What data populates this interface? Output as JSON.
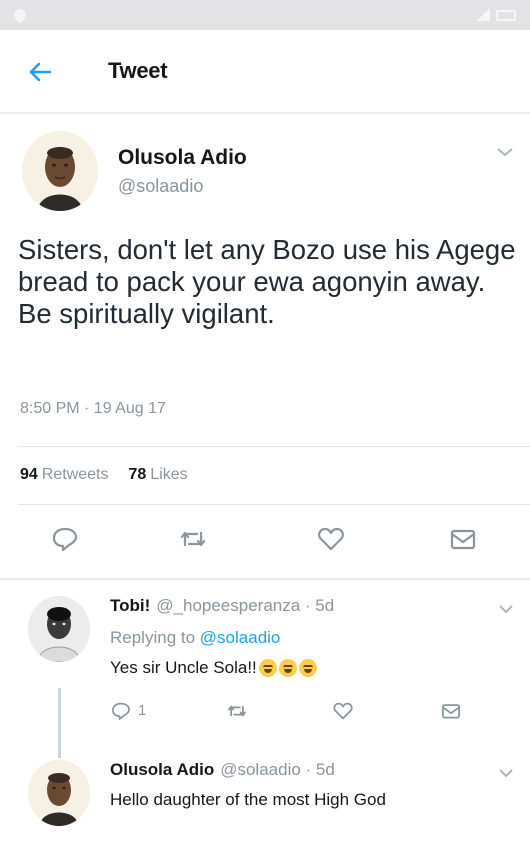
{
  "header": {
    "title": "Tweet"
  },
  "tweet": {
    "author": {
      "name": "Olusola Adio",
      "handle": "@solaadio"
    },
    "text": "Sisters, don't let any Bozo use his Agege bread to pack your ewa agonyin away. Be spiritually vigilant.",
    "timestamp": "8:50 PM · 19 Aug 17",
    "retweets_count": "94",
    "retweets_label": "Retweets",
    "likes_count": "78",
    "likes_label": "Likes"
  },
  "replies": [
    {
      "name": "Tobi!",
      "meta": "@_hopeesperanza · 5d",
      "replying_prefix": "Replying to",
      "replying_to": "@solaadio",
      "text": "Yes sir Uncle Sola!!",
      "reply_count": "1"
    },
    {
      "name": "Olusola Adio",
      "meta": "@solaadio · 5d",
      "text": "Hello daughter of the most High God"
    }
  ],
  "colors": {
    "accent": "#1da1f2",
    "muted": "#8a959e",
    "divider": "#e6ecf0"
  },
  "icons": [
    "back-arrow-icon",
    "chevron-down-icon",
    "reply-icon",
    "retweet-icon",
    "like-icon",
    "share-icon"
  ]
}
